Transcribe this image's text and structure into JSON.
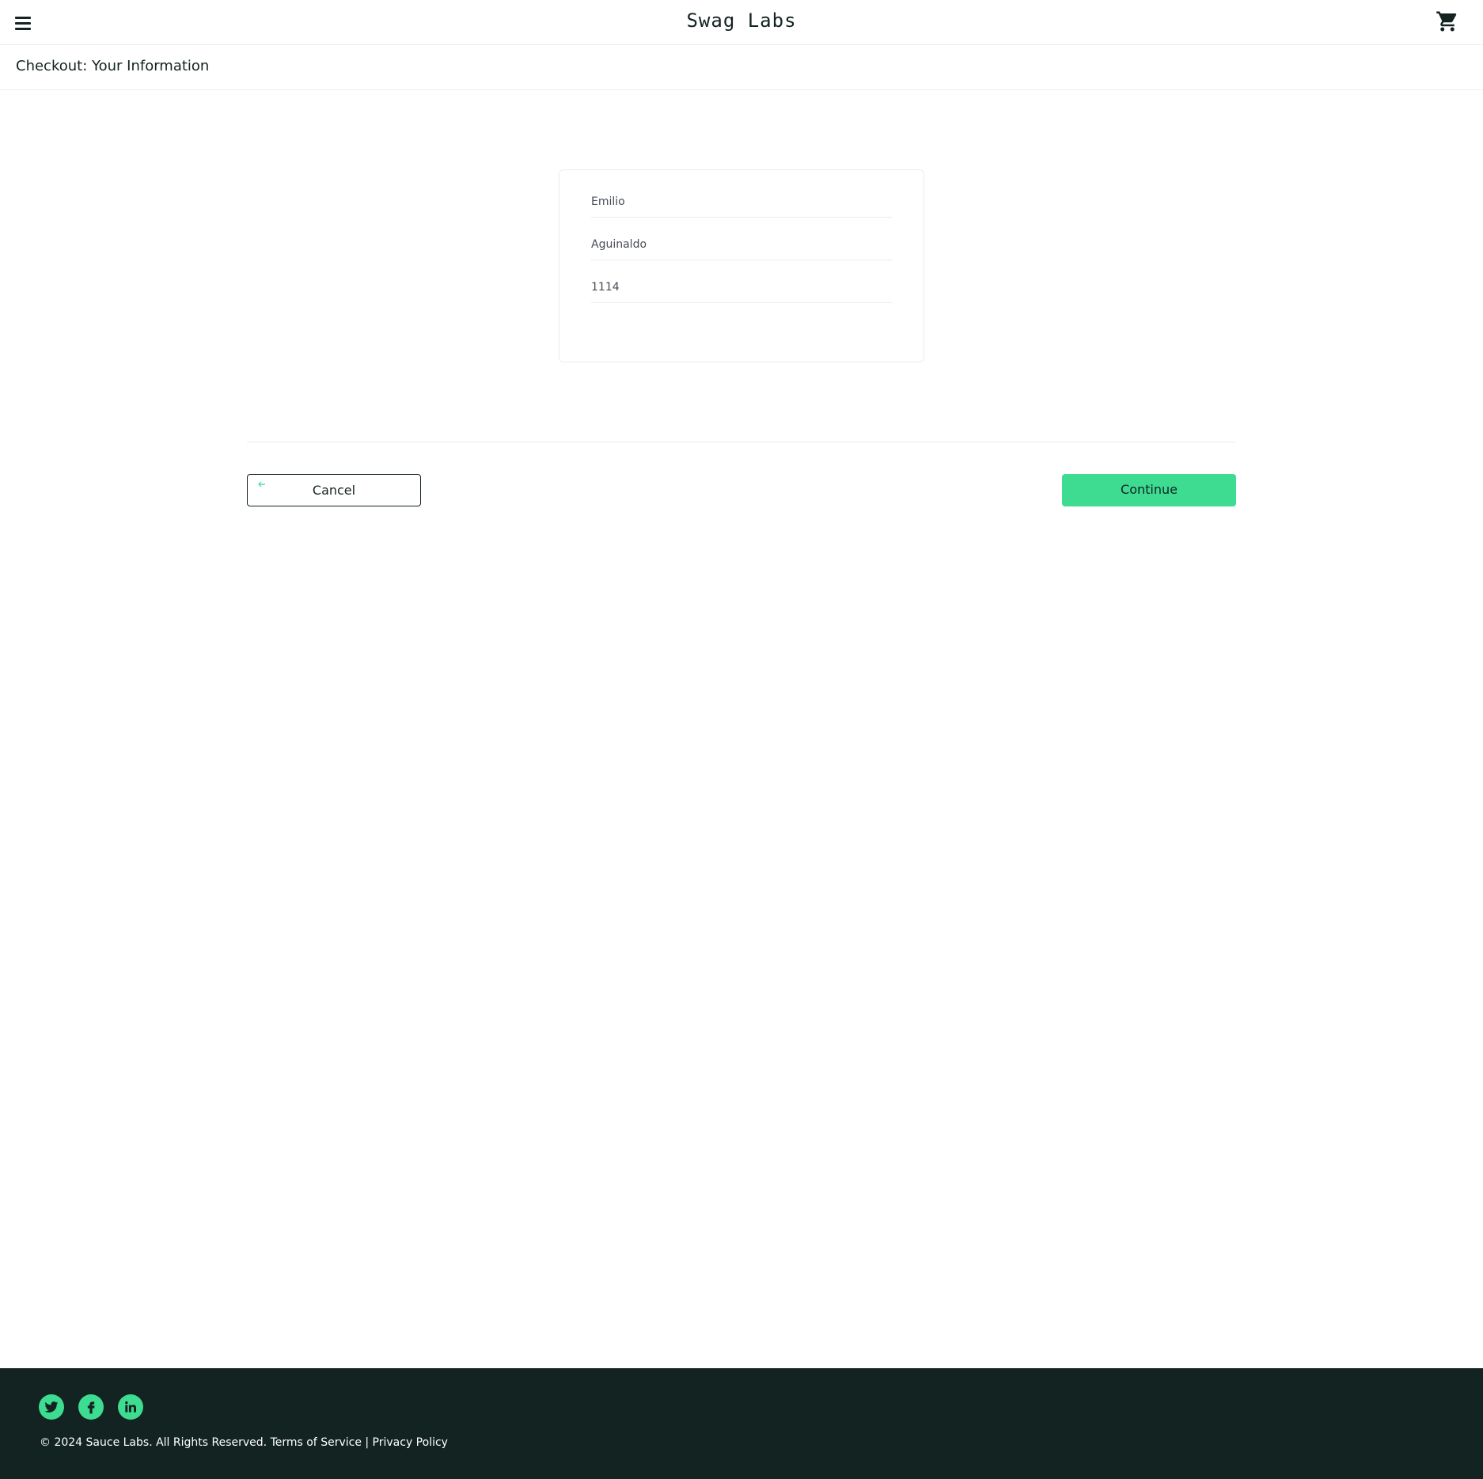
{
  "header": {
    "app_name": "Swag Labs",
    "menu_icon": "hamburger-menu-icon",
    "cart_icon": "shopping-cart-icon"
  },
  "page": {
    "title": "Checkout: Your Information"
  },
  "form": {
    "first_name": "Emilio",
    "last_name": "Aguinaldo",
    "postal_code": "1114"
  },
  "actions": {
    "cancel_label": "Cancel",
    "cancel_icon": "arrow-left-icon",
    "continue_label": "Continue"
  },
  "footer": {
    "social": [
      {
        "name": "twitter-icon"
      },
      {
        "name": "facebook-icon"
      },
      {
        "name": "linkedin-icon"
      }
    ],
    "copyright": "© 2024 Sauce Labs. All Rights Reserved. Terms of Service | Privacy Policy"
  },
  "colors": {
    "accent": "#3ddc91",
    "text": "#132322",
    "footer_bg": "#132322",
    "border": "#ededef"
  }
}
